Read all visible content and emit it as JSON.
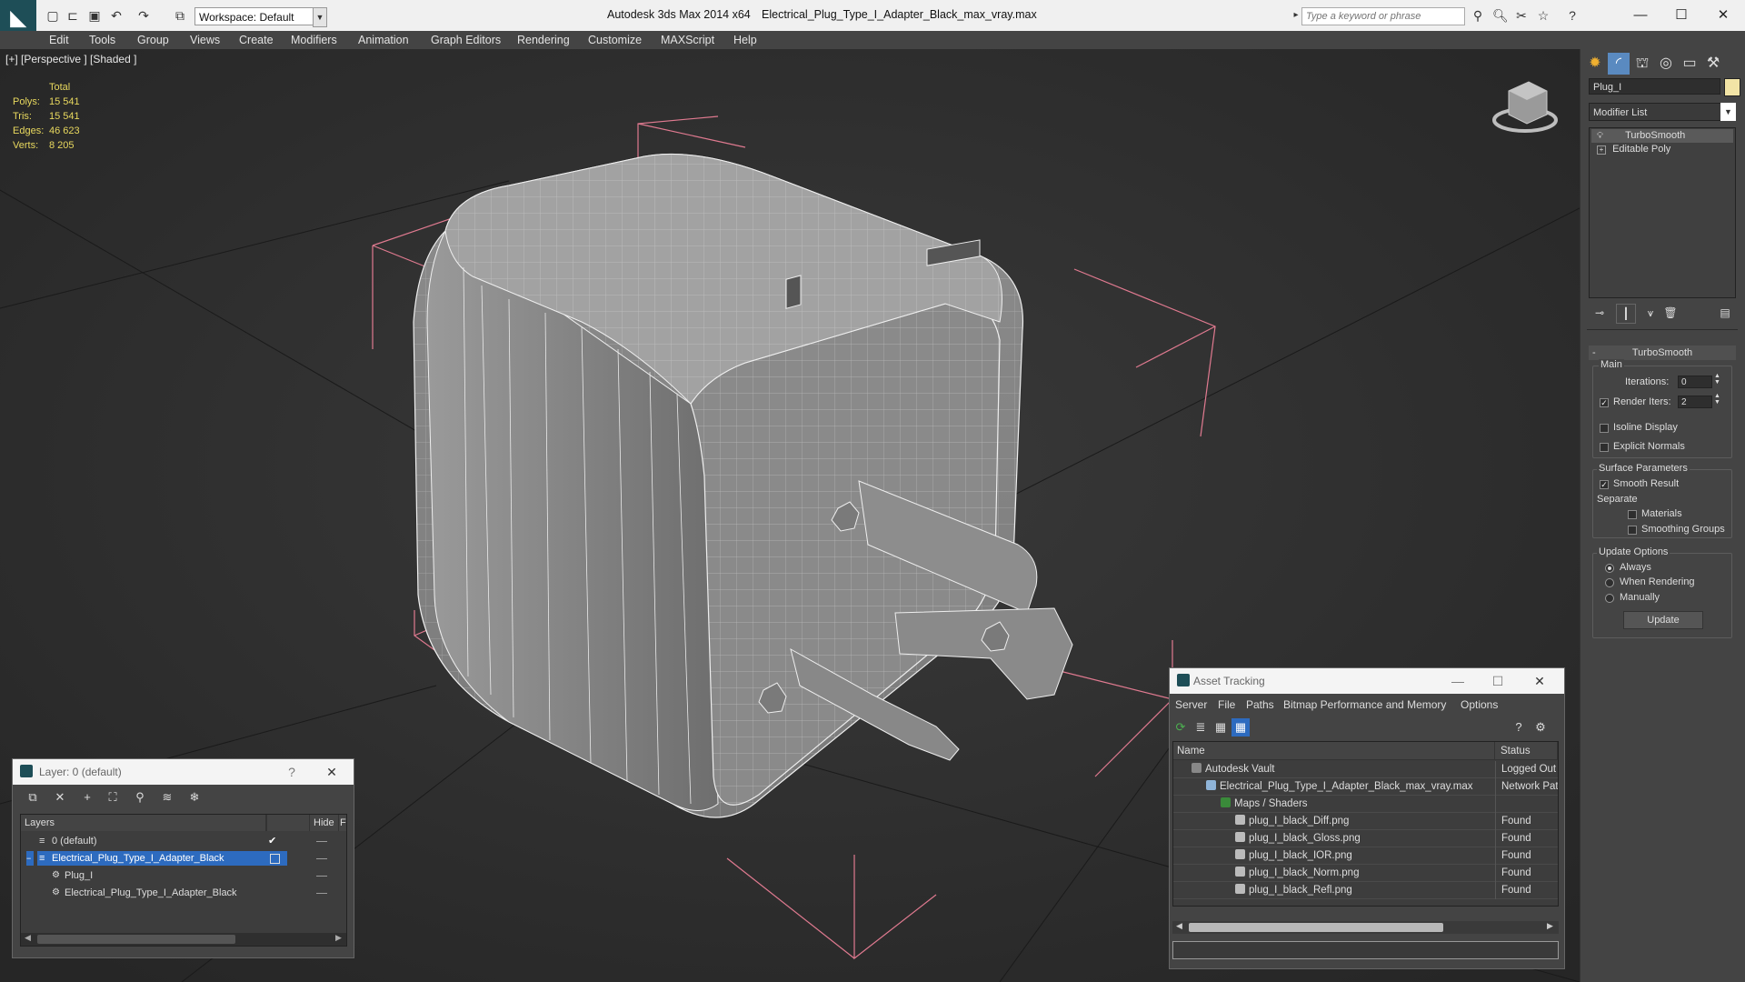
{
  "titlebar": {
    "workspace": "Workspace: Default",
    "app_title": "Autodesk 3ds Max  2014 x64",
    "file_title": "Electrical_Plug_Type_I_Adapter_Black_max_vray.max",
    "search_placeholder": "Type a keyword or phrase"
  },
  "menu": [
    "Edit",
    "Tools",
    "Group",
    "Views",
    "Create",
    "Modifiers",
    "Animation",
    "Graph Editors",
    "Rendering",
    "Customize",
    "MAXScript",
    "Help"
  ],
  "viewport": {
    "label": "[+] [Perspective ] [Shaded ]",
    "stats": {
      "header": "Total",
      "rows": [
        {
          "label": "Polys:",
          "value": "15 541"
        },
        {
          "label": "Tris:",
          "value": "15 541"
        },
        {
          "label": "Edges:",
          "value": "46 623"
        },
        {
          "label": "Verts:",
          "value": "8 205"
        }
      ]
    }
  },
  "command_panel": {
    "object_name": "Plug_I",
    "object_color": "#f2e4a6",
    "modifier_list": "Modifier List",
    "stack": [
      "TurboSmooth",
      "Editable Poly"
    ],
    "turbosmooth": {
      "header": "TurboSmooth",
      "main_group": "Main",
      "iterations_label": "Iterations:",
      "iterations_value": "0",
      "render_iters_label": "Render Iters:",
      "render_iters_value": "2",
      "isoline_display": "Isoline Display",
      "explicit_normals": "Explicit Normals",
      "surface_group": "Surface Parameters",
      "smooth_result": "Smooth Result",
      "separate": "Separate",
      "materials": "Materials",
      "smoothing_groups": "Smoothing Groups",
      "update_group": "Update Options",
      "always": "Always",
      "when_rendering": "When Rendering",
      "manually": "Manually",
      "update_button": "Update"
    }
  },
  "layer_dialog": {
    "title": "Layer: 0 (default)",
    "help": "?",
    "columns": [
      "Layers",
      "Hide",
      "F"
    ],
    "rows": [
      "0 (default)",
      "Electrical_Plug_Type_I_Adapter_Black",
      "Plug_I",
      "Electrical_Plug_Type_I_Adapter_Black"
    ]
  },
  "asset_dialog": {
    "title": "Asset Tracking",
    "menu": [
      "Server",
      "File",
      "Paths",
      "Bitmap Performance and Memory",
      "Options"
    ],
    "columns": [
      "Name",
      "Status"
    ],
    "rows": [
      {
        "name": "Autodesk Vault",
        "status": "Logged Out"
      },
      {
        "name": "Electrical_Plug_Type_I_Adapter_Black_max_vray.max",
        "status": "Network Path"
      },
      {
        "name": "Maps / Shaders",
        "status": ""
      },
      {
        "name": "plug_I_black_Diff.png",
        "status": "Found"
      },
      {
        "name": "plug_I_black_Gloss.png",
        "status": "Found"
      },
      {
        "name": "plug_I_black_IOR.png",
        "status": "Found"
      },
      {
        "name": "plug_I_black_Norm.png",
        "status": "Found"
      },
      {
        "name": "plug_I_black_Refl.png",
        "status": "Found"
      }
    ]
  }
}
